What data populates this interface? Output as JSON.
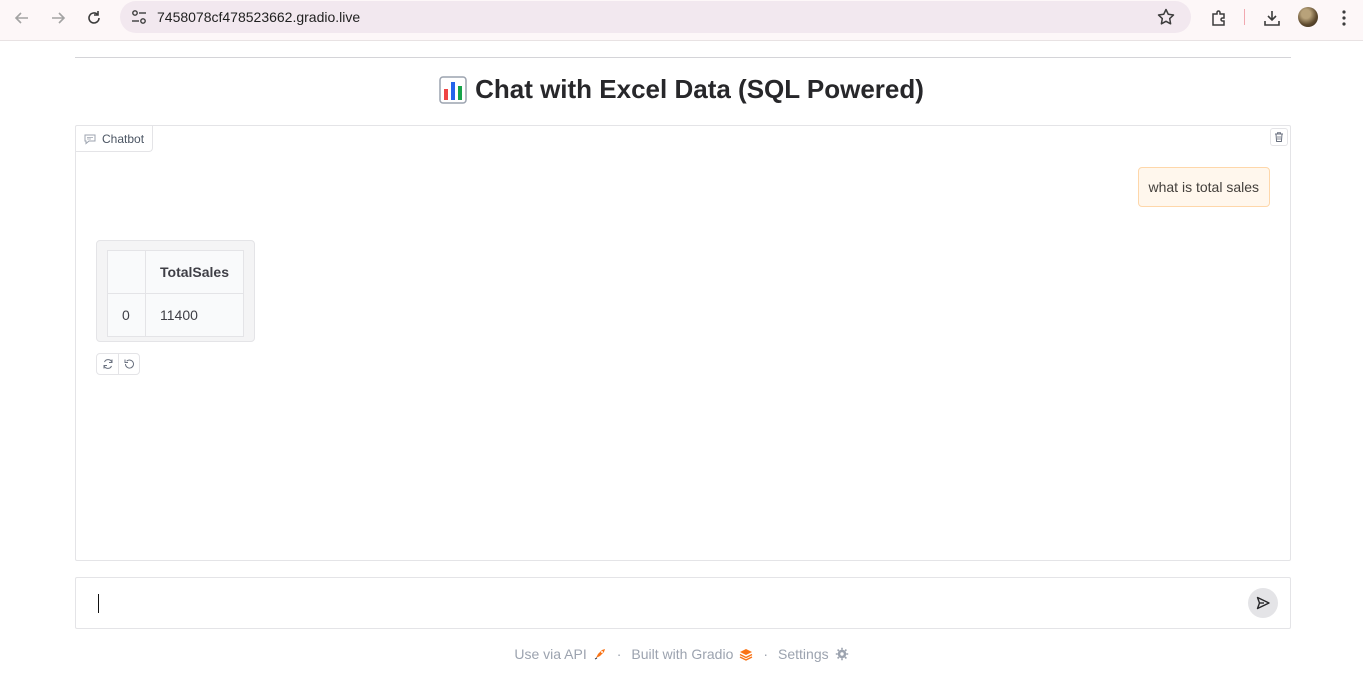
{
  "browser": {
    "url": "7458078cf478523662.gradio.live"
  },
  "app": {
    "title": "Chat with Excel Data (SQL Powered)",
    "chatbot_label": "Chatbot"
  },
  "chat": {
    "user_message": "what is total sales",
    "bot_table": {
      "headers": [
        "",
        "TotalSales"
      ],
      "rows": [
        [
          "0",
          "11400"
        ]
      ]
    }
  },
  "input": {
    "value": "",
    "placeholder": ""
  },
  "footer": {
    "api": "Use via API",
    "built": "Built with Gradio",
    "settings": "Settings",
    "separator": "·"
  },
  "colors": {
    "accent": "#f97316",
    "user_bubble": "#fff7ed"
  }
}
